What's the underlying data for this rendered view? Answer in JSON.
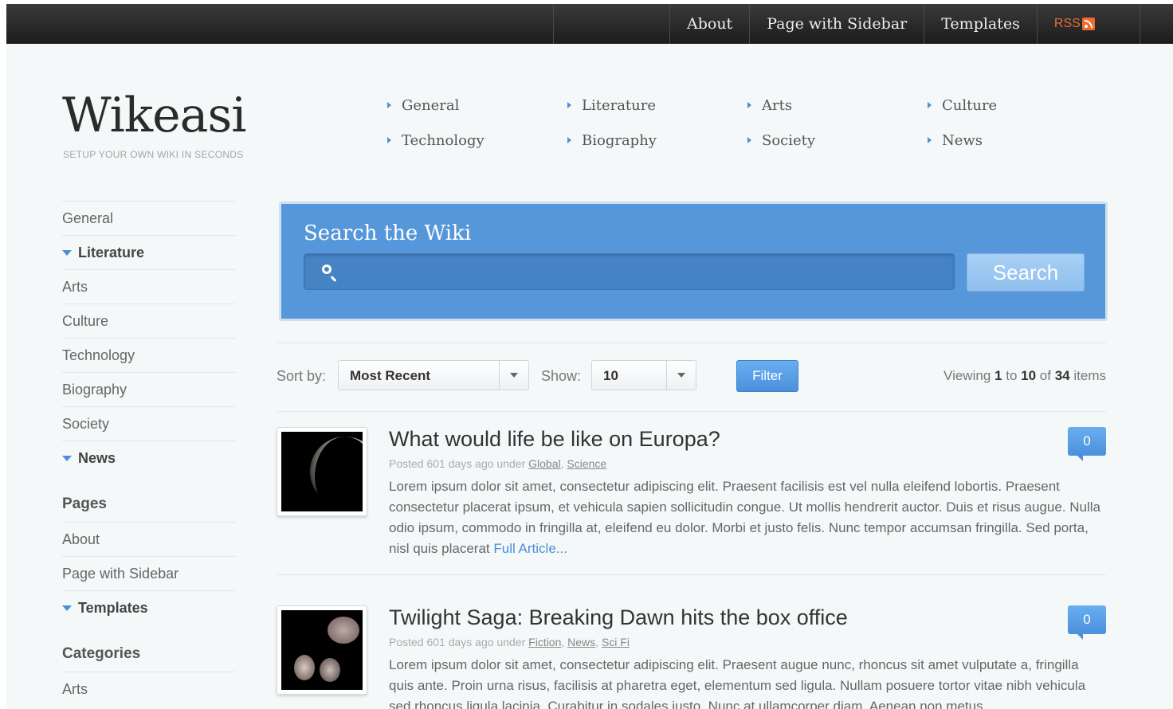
{
  "topnav": {
    "items": [
      "About",
      "Page with Sidebar",
      "Templates"
    ],
    "rss_label": "RSS"
  },
  "brand": {
    "logo": "Wikeasi",
    "tagline": "SETUP YOUR OWN WIKI IN SECONDS"
  },
  "categories": [
    "General",
    "Literature",
    "Arts",
    "Culture",
    "Technology",
    "Biography",
    "Society",
    "News"
  ],
  "sidebar": {
    "items": [
      {
        "label": "General",
        "expanded": false
      },
      {
        "label": "Literature",
        "expanded": true
      },
      {
        "label": "Arts",
        "expanded": false
      },
      {
        "label": "Culture",
        "expanded": false
      },
      {
        "label": "Technology",
        "expanded": false
      },
      {
        "label": "Biography",
        "expanded": false
      },
      {
        "label": "Society",
        "expanded": false
      },
      {
        "label": "News",
        "expanded": true
      }
    ],
    "pages_heading": "Pages",
    "pages": [
      {
        "label": "About",
        "expanded": false
      },
      {
        "label": "Page with Sidebar",
        "expanded": false
      },
      {
        "label": "Templates",
        "expanded": true
      }
    ],
    "categories_heading": "Categories",
    "categories": [
      {
        "label": "Arts",
        "expanded": false
      }
    ]
  },
  "search": {
    "title": "Search the Wiki",
    "placeholder": "",
    "button_label": "Search"
  },
  "filters": {
    "sort_label": "Sort by:",
    "sort_value": "Most Recent",
    "show_label": "Show:",
    "show_value": "10",
    "filter_button": "Filter",
    "viewing_prefix": "Viewing",
    "viewing_from": "1",
    "viewing_to_word": "to",
    "viewing_to": "10",
    "viewing_of_word": "of",
    "viewing_total": "34",
    "viewing_suffix": "items"
  },
  "articles": [
    {
      "title": "What would life be like on Europa?",
      "meta_prefix": "Posted 601 days ago under",
      "tags": [
        "Global",
        "Science"
      ],
      "body": "Lorem ipsum dolor sit amet, consectetur adipiscing elit. Praesent facilisis est vel nulla eleifend lobortis. Praesent consectetur placerat ipsum, et vehicula sapien sollicitudin congue. Ut mollis hendrerit auctor. Duis et risus augue. Nulla odio ipsum, commodo in fringilla at, eleifend eu dolor. Morbi et justo felis. Nunc tempor accumsan fringilla. Sed porta, nisl quis placerat",
      "more": "Full Article...",
      "comments": "0",
      "thumb_icon": "moon-image"
    },
    {
      "title": "Twilight Saga: Breaking Dawn hits the box office",
      "meta_prefix": "Posted 601 days ago under",
      "tags": [
        "Fiction",
        "News",
        "Sci Fi"
      ],
      "body": "Lorem ipsum dolor sit amet, consectetur adipiscing elit. Praesent augue nunc, rhoncus sit amet vulputate a, fringilla quis ante. Proin urna risus, facilisis at pharetra eget, elementum sed ligula. Nullam posuere tortor vitae nibh vehicula sed rhoncus ligula lacinia. Curabitur in sodales justo. Nunc at ullamcorper diam. Aenean non metus",
      "more": "",
      "comments": "0",
      "thumb_icon": "movie-poster-image"
    }
  ],
  "colors": {
    "accent": "#5597d9",
    "topbar": "#1c1c1c",
    "rss": "#ee6b2b"
  }
}
